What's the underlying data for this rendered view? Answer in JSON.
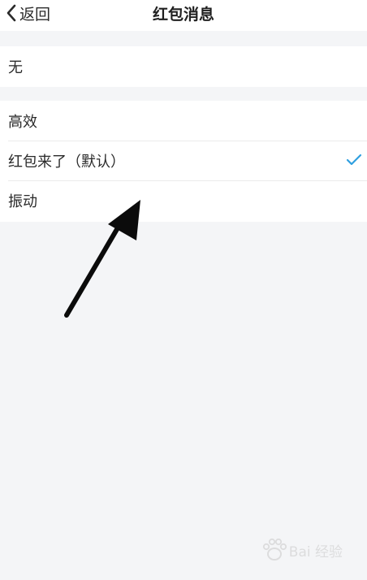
{
  "header": {
    "back_label": "返回",
    "title": "红包消息"
  },
  "options_none": {
    "items": [
      {
        "label": "无",
        "selected": false
      }
    ]
  },
  "options_sounds": {
    "items": [
      {
        "label": "高效",
        "selected": false
      },
      {
        "label": "红包来了（默认）",
        "selected": true
      },
      {
        "label": "振动",
        "selected": false
      }
    ]
  },
  "colors": {
    "check_accent": "#2f9fe0",
    "background": "#f4f5f7"
  },
  "watermark": {
    "text": "Bai 经验"
  }
}
